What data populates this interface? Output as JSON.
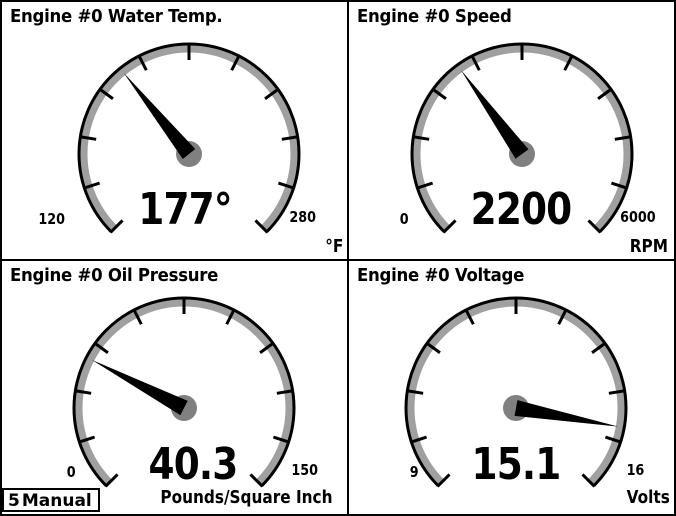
{
  "gauges": [
    {
      "title": "Engine #0 Water Temp.",
      "value": 177,
      "readout": "177°",
      "min": 120,
      "max": 280,
      "min_label": "120",
      "max_label": "280",
      "unit": "°F"
    },
    {
      "title": "Engine #0 Speed",
      "value": 2200,
      "readout": "2200",
      "min": 0,
      "max": 6000,
      "min_label": "0",
      "max_label": "6000",
      "unit": "RPM"
    },
    {
      "title": "Engine #0 Oil Pressure",
      "value": 40.3,
      "readout": "40.3",
      "min": 0,
      "max": 150,
      "min_label": "0",
      "max_label": "150",
      "unit": "Pounds/Square Inch"
    },
    {
      "title": "Engine #0 Voltage",
      "value": 15.1,
      "readout": "15.1",
      "min": 9,
      "max": 16,
      "min_label": "9",
      "max_label": "16",
      "unit": "Volts"
    }
  ],
  "mode": {
    "page": "5",
    "label": "Manual"
  },
  "colors": {
    "dial_track": "#a0a0a0",
    "needle": "#000000",
    "hub": "#808080"
  }
}
